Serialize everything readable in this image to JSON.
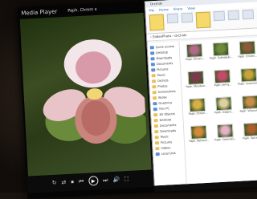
{
  "player": {
    "title": "Media Player",
    "file": "Paph. Chrom x",
    "controls": [
      "↻",
      "⇄",
      "⏹",
      "⏮",
      "▶",
      "⏭",
      "🔊",
      "⛶"
    ]
  },
  "explorer": {
    "title": "Orchids",
    "menu": [
      "File",
      "Home",
      "Share",
      "View"
    ],
    "address": "› SlidesPhoto › Orchids",
    "nav": [
      {
        "label": "Quick access",
        "icon": "star"
      },
      {
        "label": "Desktop",
        "icon": "folder-blue"
      },
      {
        "label": "Downloads",
        "icon": "folder-blue"
      },
      {
        "label": "Documents",
        "icon": "folder-blue"
      },
      {
        "label": "Pictures",
        "icon": "folder-blue"
      },
      {
        "label": "Music",
        "icon": "folder"
      },
      {
        "label": "Orchids",
        "icon": "folder"
      },
      {
        "label": "Photos",
        "icon": "folder"
      },
      {
        "label": "Screenshots",
        "icon": "folder"
      },
      {
        "label": "Slides",
        "icon": "folder"
      },
      {
        "label": "OneDrive",
        "icon": "folder-blue"
      },
      {
        "label": "This PC",
        "icon": "folder-blue"
      },
      {
        "label": "3D Objects",
        "icon": "folder"
      },
      {
        "label": "Desktop",
        "icon": "folder"
      },
      {
        "label": "Documents",
        "icon": "folder"
      },
      {
        "label": "Downloads",
        "icon": "folder"
      },
      {
        "label": "Music",
        "icon": "folder"
      },
      {
        "label": "Pictures",
        "icon": "folder"
      },
      {
        "label": "Videos",
        "icon": "folder"
      },
      {
        "label": "Local Disk",
        "icon": "folder-blue"
      }
    ],
    "files": [
      {
        "name": "Paph. Chrom...",
        "color": "#b36a8a"
      },
      {
        "name": "Paph. Sukhakulii...",
        "color": "#6f8a3d"
      },
      {
        "name": "Paph. Chrom...",
        "color": "#8a5a3a"
      },
      {
        "name": "Paph. Maudiae...",
        "color": "#7b3b4d"
      },
      {
        "name": "Paph. Jenny...",
        "color": "#c54a6a"
      },
      {
        "name": "Paph. Leeanum...",
        "color": "#c7a33a"
      },
      {
        "name": "Paph. Chrom...",
        "color": "#d8b04a"
      },
      {
        "name": "Paph. Insigne...",
        "color": "#e0d0a0"
      },
      {
        "name": "Paph. Villosum...",
        "color": "#c98a4a"
      },
      {
        "name": "Paph. Rothsch...",
        "color": "#d28a3a"
      },
      {
        "name": "Paph. Delenatii...",
        "color": "#e6b0c8"
      },
      {
        "name": "Paph. Spicer...",
        "color": "#a86030"
      }
    ]
  }
}
